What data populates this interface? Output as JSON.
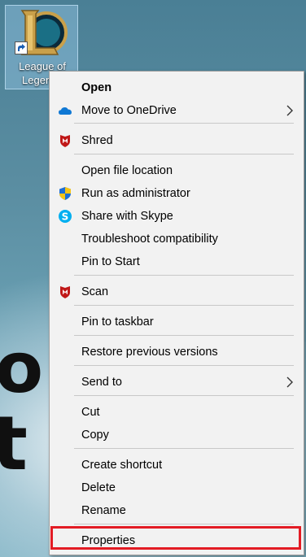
{
  "desktop": {
    "background_words": [
      "o",
      "t w"
    ],
    "icon": {
      "label": "League of Legends",
      "icon_name": "league-of-legends-logo",
      "selected": true
    }
  },
  "context_menu": {
    "items": [
      {
        "label": "Open",
        "bold": true,
        "icon": ""
      },
      {
        "label": "Move to OneDrive",
        "icon": "onedrive-cloud-icon",
        "submenu": true
      },
      {
        "label": "Shred",
        "icon": "mcafee-shield-icon"
      },
      {
        "label": "Open file location",
        "icon": ""
      },
      {
        "label": "Run as administrator",
        "icon": "uac-shield-icon"
      },
      {
        "label": "Share with Skype",
        "icon": "skype-icon"
      },
      {
        "label": "Troubleshoot compatibility",
        "icon": ""
      },
      {
        "label": "Pin to Start",
        "icon": ""
      },
      {
        "label": "Scan",
        "icon": "mcafee-shield-icon"
      },
      {
        "label": "Pin to taskbar",
        "icon": ""
      },
      {
        "label": "Restore previous versions",
        "icon": ""
      },
      {
        "label": "Send to",
        "icon": "",
        "submenu": true
      },
      {
        "label": "Cut",
        "icon": ""
      },
      {
        "label": "Copy",
        "icon": ""
      },
      {
        "label": "Create shortcut",
        "icon": ""
      },
      {
        "label": "Delete",
        "icon": ""
      },
      {
        "label": "Rename",
        "icon": ""
      },
      {
        "label": "Properties",
        "icon": "",
        "highlighted": true
      }
    ],
    "highlight_color": "#e31c24"
  }
}
